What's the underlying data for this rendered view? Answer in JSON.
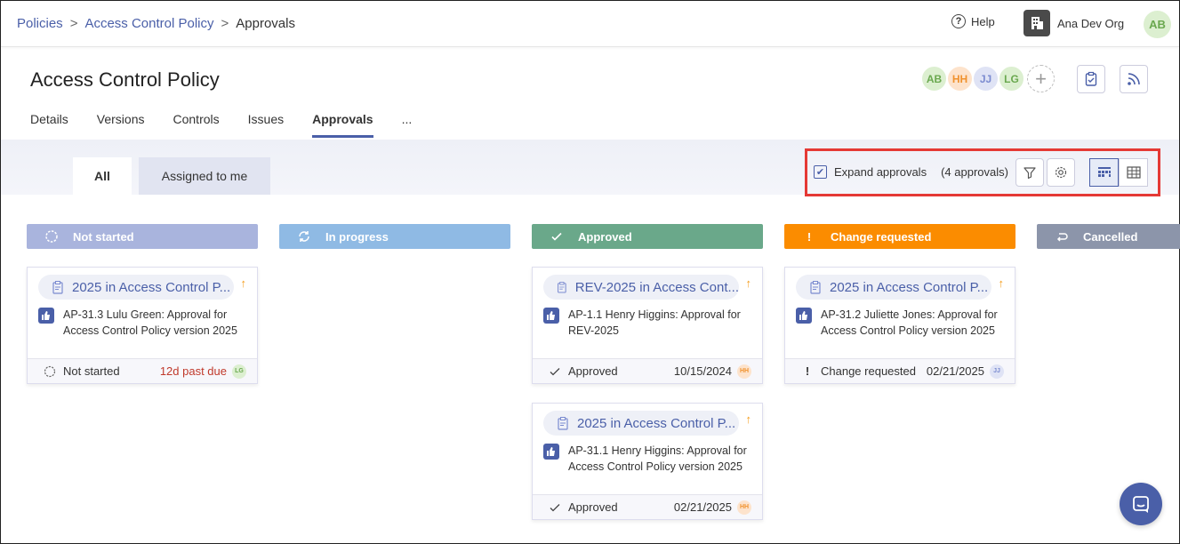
{
  "breadcrumb": {
    "items": [
      "Policies",
      "Access Control Policy",
      "Approvals"
    ],
    "sep": ">"
  },
  "header": {
    "help": "Help",
    "org": "Ana Dev Org",
    "user_initials": "AB"
  },
  "page": {
    "title": "Access Control Policy"
  },
  "members": [
    {
      "initials": "AB",
      "bg": "#dcefd0",
      "fg": "#6aa84f"
    },
    {
      "initials": "HH",
      "bg": "#fde3cc",
      "fg": "#f0922e"
    },
    {
      "initials": "JJ",
      "bg": "#dfe3f5",
      "fg": "#7b8bd0"
    },
    {
      "initials": "LG",
      "bg": "#dcefd0",
      "fg": "#6aa84f"
    }
  ],
  "tabs": [
    "Details",
    "Versions",
    "Controls",
    "Issues",
    "Approvals",
    "..."
  ],
  "filter_tabs": {
    "all": "All",
    "mine": "Assigned to me"
  },
  "toolbar": {
    "expand_label": "Expand approvals",
    "count": "(4 approvals)"
  },
  "columns": [
    {
      "label": "Not started",
      "color": "#a9b4dd",
      "icon": "circle-dashed-icon"
    },
    {
      "label": "In progress",
      "color": "#8fbae4",
      "icon": "refresh-icon"
    },
    {
      "label": "Approved",
      "color": "#6aa88a",
      "icon": "check-icon"
    },
    {
      "label": "Change requested",
      "color": "#fb8c00",
      "icon": "exclamation-icon"
    },
    {
      "label": "Cancelled",
      "color": "#8c95aa",
      "icon": "undo-icon"
    }
  ],
  "cards": [
    {
      "title": "2025 in Access Control P...",
      "desc1": "AP-31.3 Lulu Green: Approval for",
      "desc2": "Access Control Policy version 2025",
      "status": "Not started",
      "due": "12d past due",
      "due_color": "#c0392b",
      "assignee": "LG"
    },
    {
      "title": "REV-2025 in Access Cont...",
      "desc1": "AP-1.1 Henry Higgins: Approval for",
      "desc2": "REV-2025",
      "status": "Approved",
      "due": "10/15/2024",
      "due_color": "#333333",
      "assignee": "HH"
    },
    {
      "title": "2025 in Access Control P...",
      "desc1": "AP-31.1 Henry Higgins: Approval for",
      "desc2": "Access Control Policy version 2025",
      "status": "Approved",
      "due": "02/21/2025",
      "due_color": "#333333",
      "assignee": "HH"
    },
    {
      "title": "2025 in Access Control P...",
      "desc1": "AP-31.2 Juliette Jones: Approval for",
      "desc2": "Access Control Policy version 2025",
      "status": "Change requested",
      "due": "02/21/2025",
      "due_color": "#333333",
      "assignee": "JJ"
    }
  ]
}
